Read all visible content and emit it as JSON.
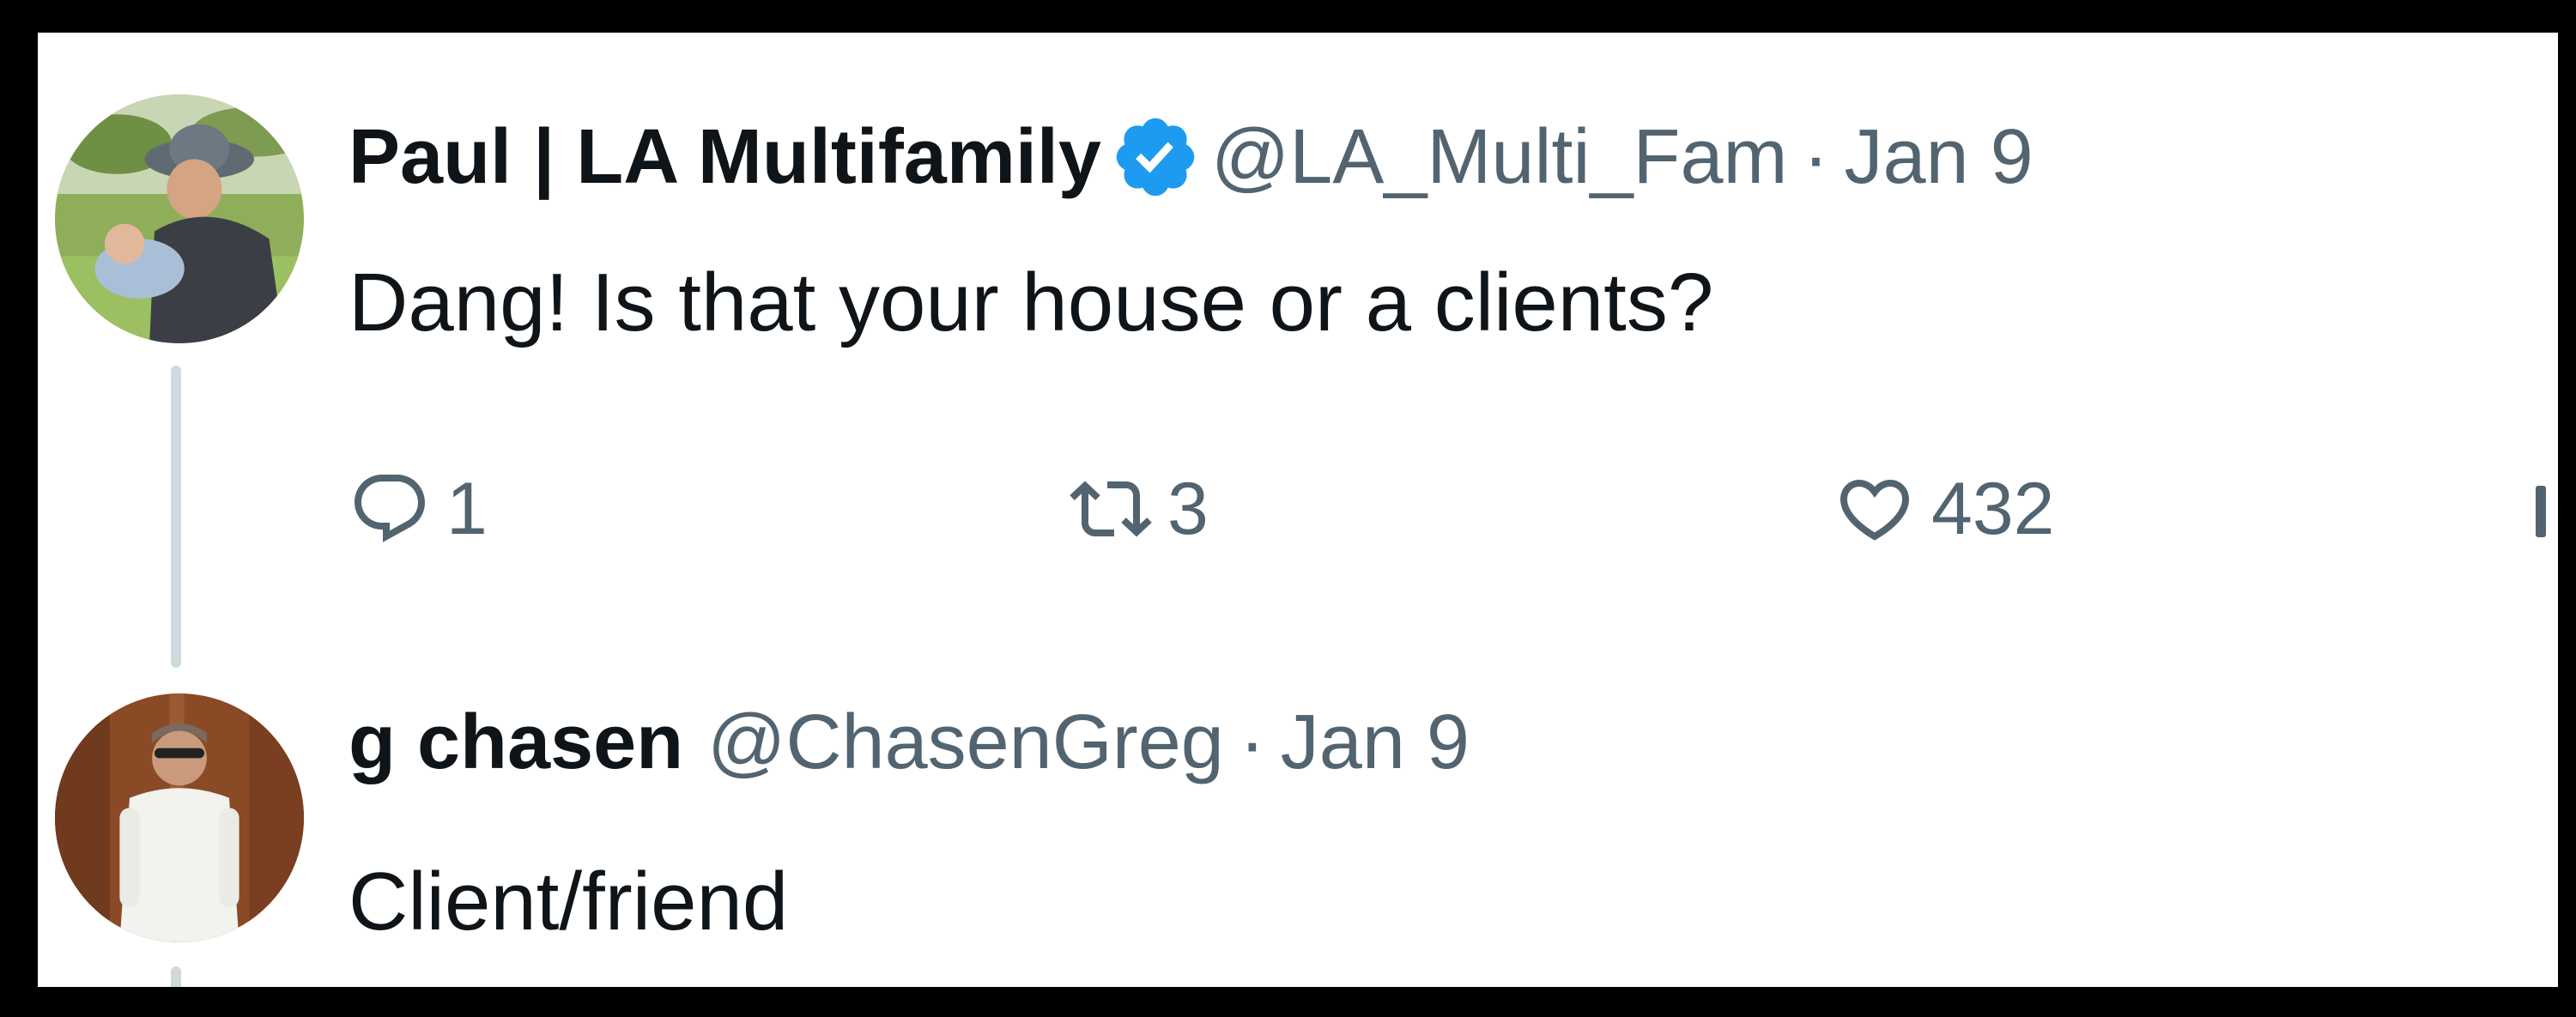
{
  "tweets": [
    {
      "author": {
        "name": "Paul | LA Multifamily",
        "handle": "@LA_Multi_Fam",
        "verified": true,
        "avatar_icon": "avatar-photo-paul"
      },
      "separator": "·",
      "date": "Jan 9",
      "text": "Dang! Is that your house or a clients?",
      "actions": {
        "reply_count": "1",
        "retweet_count": "3",
        "like_count": "432"
      }
    },
    {
      "author": {
        "name": "g chasen",
        "handle": "@ChasenGreg",
        "verified": false,
        "avatar_icon": "avatar-photo-g-chasen"
      },
      "separator": "·",
      "date": "Jan 9",
      "text": "Client/friend"
    }
  ],
  "icons": {
    "verified": "verified-badge-icon",
    "reply": "reply-icon",
    "retweet": "retweet-icon",
    "like": "heart-icon",
    "views": "views-icon"
  },
  "colors": {
    "background": "#ffffff",
    "frame": "#000000",
    "primary_text": "#0f1419",
    "secondary_text": "#536471",
    "verified_blue": "#1d9bf0",
    "thread_line": "#cfd9de"
  }
}
